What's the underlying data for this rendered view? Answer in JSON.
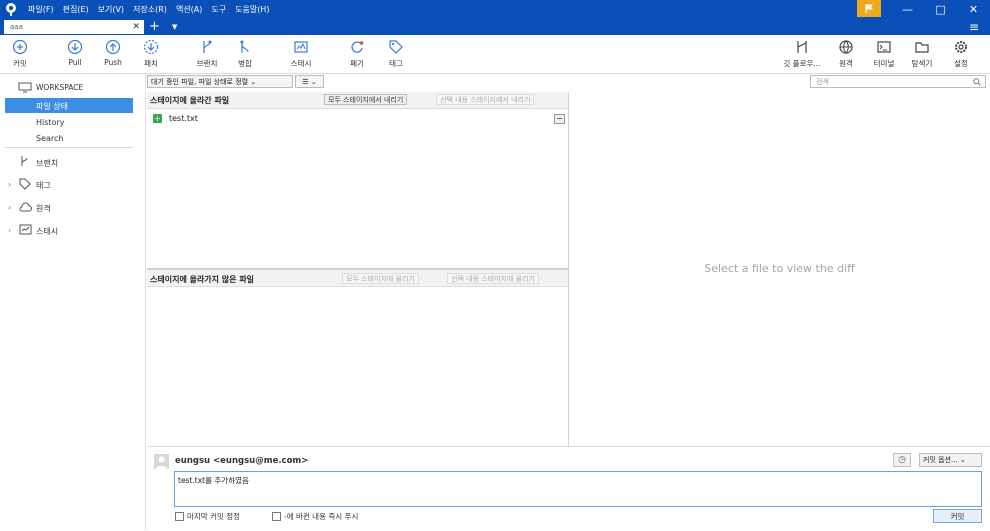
{
  "menu": [
    "파일(F)",
    "편집(E)",
    "보기(V)",
    "저장소(R)",
    "액션(A)",
    "도구",
    "도움말(H)"
  ],
  "window_controls": [
    "—",
    "□",
    "✕"
  ],
  "flag_icon": "flag-icon",
  "tab": {
    "label": "aaa",
    "close": "✕",
    "add": "+",
    "dropdown": "▼"
  },
  "hamburger": "≡",
  "toolbar": {
    "commit": "커밋",
    "pull": "Pull",
    "push": "Push",
    "fetch": "패치",
    "branch": "브랜치",
    "merge": "병합",
    "stash": "스태시",
    "discard": "폐기",
    "tag": "태그",
    "gitflow": "깃 플로우...",
    "remote": "원격",
    "terminal": "터미널",
    "explorer": "탐색기",
    "settings": "설정"
  },
  "sidebar": {
    "workspace": "WORKSPACE",
    "file_status": "파일 상태",
    "history": "History",
    "search": "Search",
    "branches": "브랜치",
    "tags": "태그",
    "remotes": "원격",
    "stashes": "스태시"
  },
  "filter": {
    "value": "대기 중인 파일, 파일 상태로 정렬",
    "view": "☰",
    "search_placeholder": "검색"
  },
  "staged": {
    "title": "스테이지에 올라간 파일",
    "unstage_all": "모두 스테이지에서 내리기",
    "unstage_selected": "선택 내용 스테이지에서 내리기",
    "files": [
      {
        "name": "test.txt",
        "status": "added"
      }
    ]
  },
  "unstaged": {
    "title": "스테이지에 올라가지 않은 파일",
    "stage_all": "모두 스테이지에 올리기",
    "stage_selected": "선택 내용 스테이지에 올리기"
  },
  "diff": {
    "placeholder": "Select a file to view the diff"
  },
  "commit": {
    "author": "eungsu <eungsu@me.com>",
    "message": "test.txt를 추가하였음",
    "options": "커밋 옵션...",
    "amend": "마지막 커밋 정정",
    "push_immediately": "-에 바뀐 내용 즉시 푸시",
    "button": "커밋"
  }
}
